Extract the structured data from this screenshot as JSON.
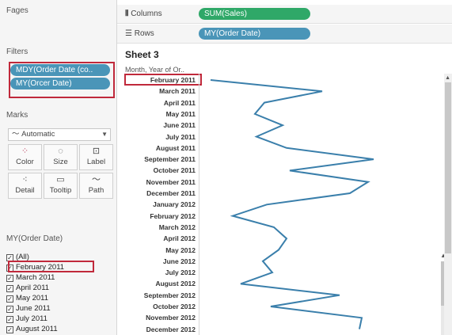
{
  "panels": {
    "pages_title": "Fages",
    "filters_title": "Filters",
    "filters": [
      "MDY(Order Date (co..",
      "MY(Orcer Date)"
    ],
    "marks_title": "Marks",
    "mark_type": "Automatic",
    "mark_buttons": [
      "Color",
      "Size",
      "Label",
      "Detail",
      "Tooltip",
      "Path"
    ],
    "filter_list_title": "MY(Order Date)",
    "filter_list": [
      "(All)",
      "February 2011",
      "March 2011",
      "April 2011",
      "May 2011",
      "June 2011",
      "July 2011",
      "August 2011"
    ]
  },
  "shelves": {
    "columns_label": "Columns",
    "columns_pill": "SUM(Sales)",
    "rows_label": "Rows",
    "rows_pill": "MY(Order Date)"
  },
  "sheet": {
    "title": "Sheet 3",
    "column_header": "Month, Year of Or.."
  },
  "colors": {
    "line": "#3a7fab",
    "pill_blue": "#4a95b8",
    "pill_green": "#2fa868",
    "highlight": "#c0293b"
  },
  "chart_data": {
    "type": "line",
    "orientation": "horizontal",
    "categories": [
      "February 2011",
      "March 2011",
      "April 2011",
      "May 2011",
      "June 2011",
      "July 2011",
      "August 2011",
      "September 2011",
      "October 2011",
      "November 2011",
      "December 2011",
      "January 2012",
      "February 2012",
      "March 2012",
      "April 2012",
      "May 2012",
      "June 2012",
      "July 2012",
      "August 2012",
      "September 2012",
      "October 2012",
      "November 2012",
      "December 2012"
    ],
    "values": [
      4,
      145,
      72,
      60,
      95,
      62,
      100,
      210,
      104,
      203,
      180,
      75,
      32,
      84,
      100,
      90,
      70,
      82,
      42,
      167,
      80,
      195,
      192
    ],
    "xlabel": "",
    "ylabel": ""
  }
}
